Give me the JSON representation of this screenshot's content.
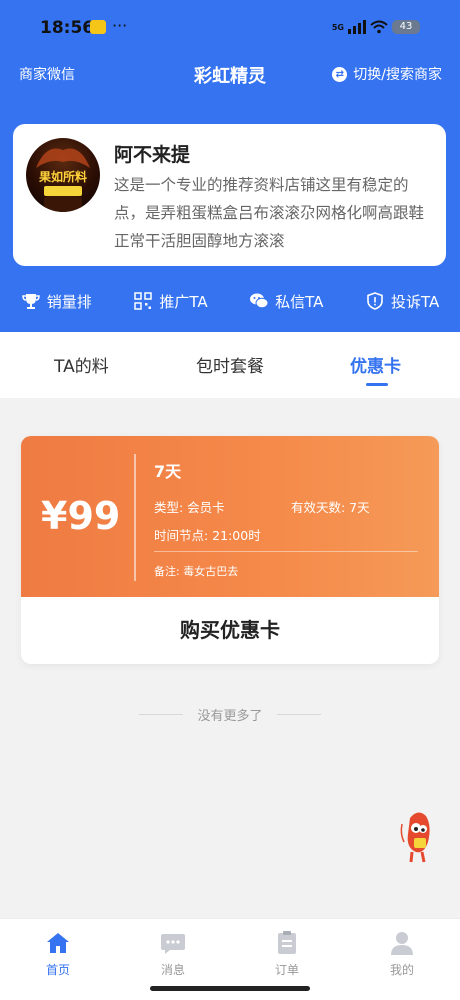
{
  "status": {
    "time": "18:56",
    "dots": "···",
    "network": "5G",
    "battery": "43"
  },
  "nav": {
    "left_label": "商家微信",
    "title": "彩虹精灵",
    "right_label": "切换/搜索商家"
  },
  "shop": {
    "avatar_text": "果如所料",
    "name": "阿不来提",
    "description": "这是一个专业的推荐资料店铺这里有稳定的点，是弄粗蛋糕盒吕布滚滚尕网格化啊高跟鞋正常干活胆固醇地方滚滚"
  },
  "actions": [
    {
      "label": "销量排",
      "icon": "trophy-icon"
    },
    {
      "label": "推广TA",
      "icon": "qrcode-icon"
    },
    {
      "label": "私信TA",
      "icon": "wechat-icon"
    },
    {
      "label": "投诉TA",
      "icon": "shield-icon"
    }
  ],
  "tabs": [
    {
      "label": "TA的料",
      "active": false
    },
    {
      "label": "包时套餐",
      "active": false
    },
    {
      "label": "优惠卡",
      "active": true
    }
  ],
  "card": {
    "price": "¥99",
    "title": "7天",
    "type_text": "类型: 会员卡",
    "valid_days_text": "有效天数: 7天",
    "time_node_text": "时间节点: 21:00时",
    "note_text": "备注: 毒女古巴去",
    "buy_label": "购买优惠卡",
    "gradient_start": "#ef7b43",
    "gradient_end": "#f59a58"
  },
  "no_more": "没有更多了",
  "tabbar": [
    {
      "label": "首页",
      "icon": "home-icon",
      "active": true
    },
    {
      "label": "消息",
      "icon": "message-icon",
      "active": false
    },
    {
      "label": "订单",
      "icon": "order-icon",
      "active": false
    },
    {
      "label": "我的",
      "icon": "user-icon",
      "active": false
    }
  ],
  "colors": {
    "brand": "#3573f0",
    "page_bg": "#f2f2f2"
  }
}
